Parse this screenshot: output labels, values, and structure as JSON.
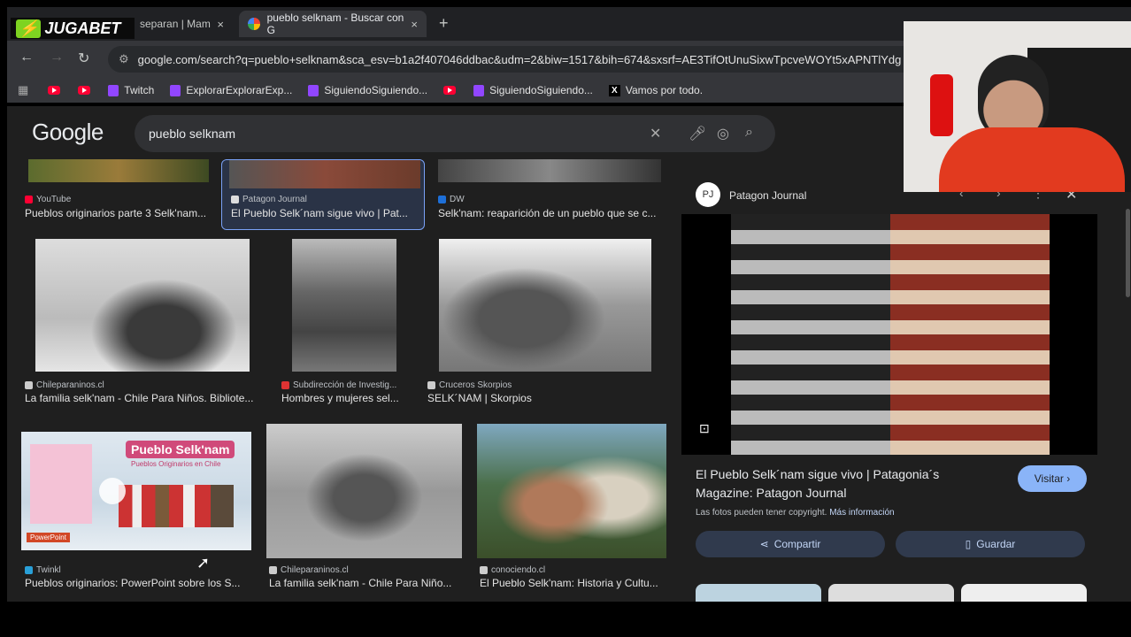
{
  "tabs": [
    {
      "label": "separan | Mam",
      "close": "×"
    },
    {
      "label": "pueblo selknam - Buscar con G",
      "close": "×"
    }
  ],
  "jugabet_logo": "JUGABET",
  "new_tab": "+",
  "address": {
    "url": "google.com/search?q=pueblo+selknam&sca_esv=b1a2f407046ddbac&udm=2&biw=1517&bih=674&sxsrf=AE3TifOtUnuSixwTpcveWOYt5xAPNTlYdg"
  },
  "bookmarks": [
    {
      "label": "Twitch"
    },
    {
      "label": "ExplorarExplorarExp..."
    },
    {
      "label": "SiguiendoSiguiendo..."
    },
    {
      "label": "SiguiendoSiguiendo..."
    },
    {
      "label": "Vamos por todo."
    }
  ],
  "google": {
    "logo": "Google",
    "query": "pueblo selknam"
  },
  "results": [
    {
      "source": "YouTube",
      "title": "Pueblos originarios parte 3 Selk'nam..."
    },
    {
      "source": "Patagon Journal",
      "title": "El Pueblo Selk´nam sigue vivo | Pat..."
    },
    {
      "source": "DW",
      "title": "Selk'nam: reaparición de un pueblo que se c..."
    },
    {
      "source": "Chileparaninos.cl",
      "title": "La familia selk'nam - Chile Para Niños. Bibliote..."
    },
    {
      "source": "Subdirección de Investig...",
      "title": "Hombres y mujeres sel..."
    },
    {
      "source": "Cruceros Skorpios",
      "title": "SELK´NAM | Skorpios"
    },
    {
      "source": "Twinkl",
      "title": "Pueblos originarios: PowerPoint sobre los S..."
    },
    {
      "source": "Chileparaninos.cl",
      "title": "La familia selk'nam - Chile Para Niño..."
    },
    {
      "source": "conociendo.cl",
      "title": "El Pueblo Selk'nam: Historia y Cultu..."
    }
  ],
  "thumb_text": {
    "heading": "Pueblo Selk'nam",
    "sub": "Pueblos Originarios en Chile",
    "badge": "PowerPoint"
  },
  "panel": {
    "source": "Patagon Journal",
    "source_initials": "PJ",
    "title": "El Pueblo Selk´nam sigue vivo | Patagonia´s Magazine: Patagon Journal",
    "copyright": "Las fotos pueden tener copyright.",
    "more_info": "Más información",
    "visit": "Visitar",
    "share": "Compartir",
    "save": "Guardar"
  }
}
